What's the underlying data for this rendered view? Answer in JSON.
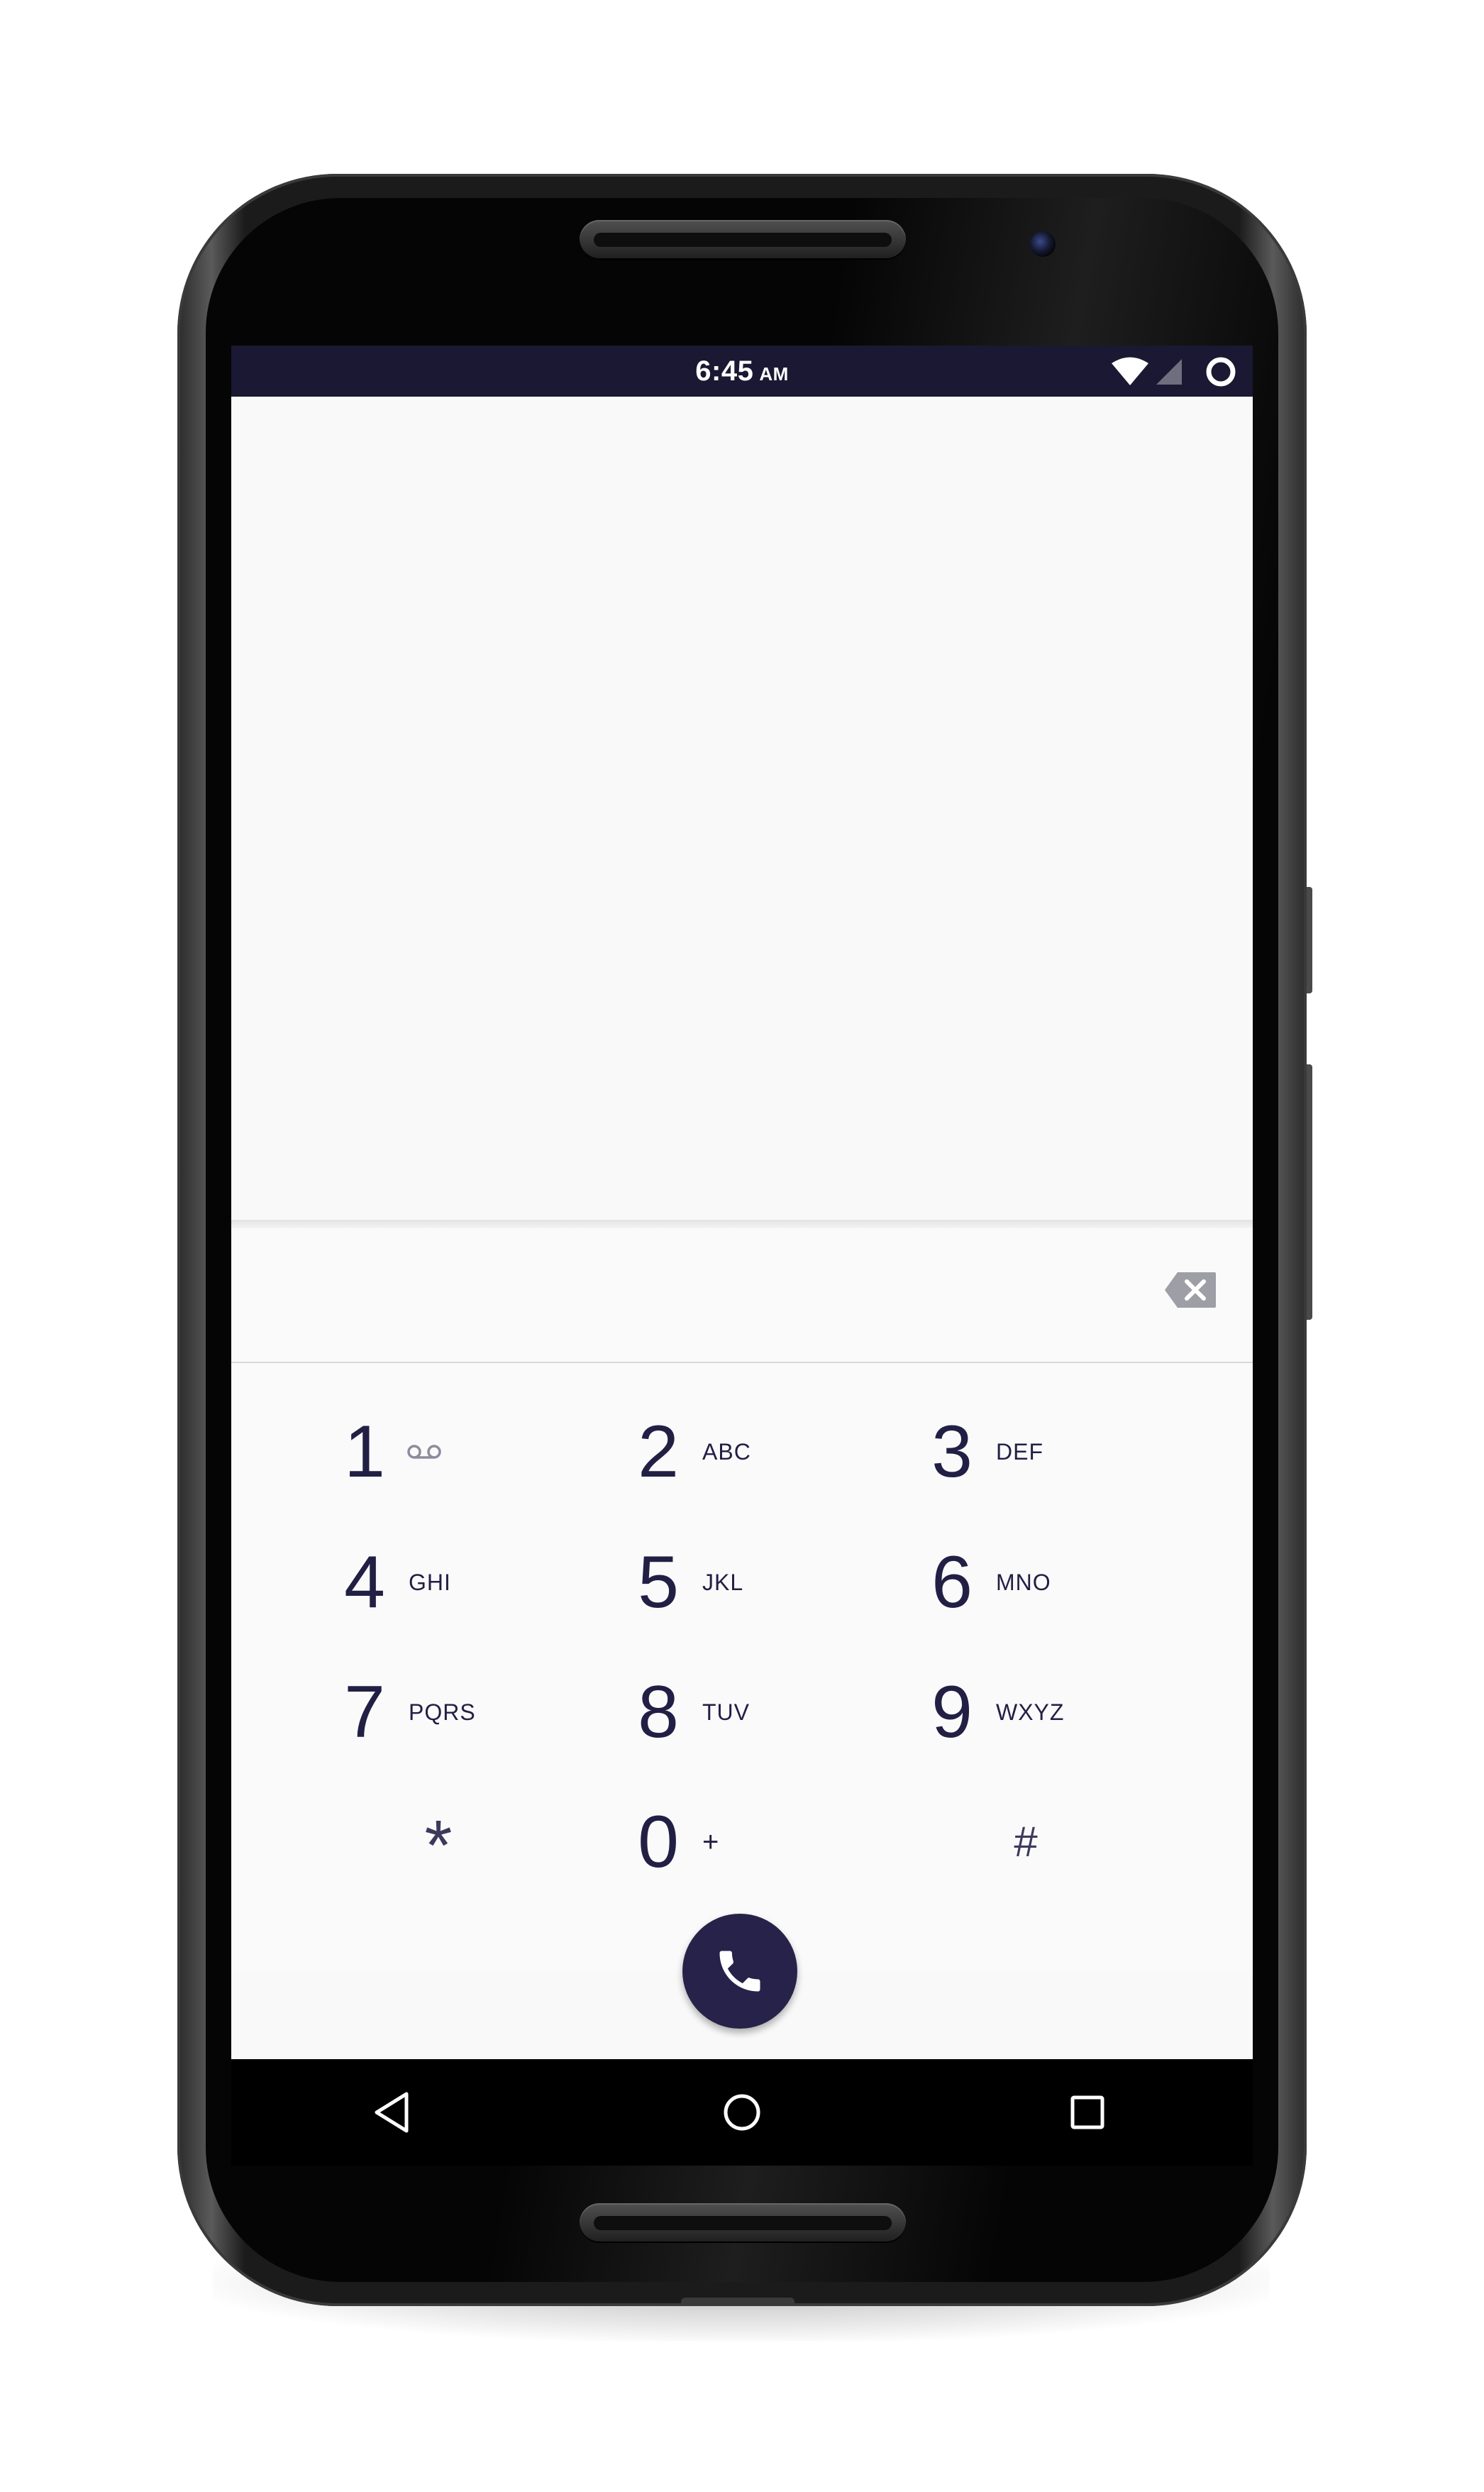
{
  "status_bar": {
    "time": "6:45",
    "ampm": "AM",
    "icons": [
      "wifi-icon",
      "cellular-signal-icon",
      "battery-charging-icon"
    ]
  },
  "dialer": {
    "digits_value": "",
    "digits_placeholder": "",
    "backspace_icon": "backspace-icon",
    "keys": [
      {
        "digit": "1",
        "letters": "",
        "icon": "voicemail-icon"
      },
      {
        "digit": "2",
        "letters": "ABC"
      },
      {
        "digit": "3",
        "letters": "DEF"
      },
      {
        "digit": "4",
        "letters": "GHI"
      },
      {
        "digit": "5",
        "letters": "JKL"
      },
      {
        "digit": "6",
        "letters": "MNO"
      },
      {
        "digit": "7",
        "letters": "PQRS"
      },
      {
        "digit": "8",
        "letters": "TUV"
      },
      {
        "digit": "9",
        "letters": "WXYZ"
      },
      {
        "digit": "*",
        "letters": ""
      },
      {
        "digit": "0",
        "letters": "+"
      },
      {
        "digit": "#",
        "letters": ""
      }
    ],
    "call_icon": "phone-icon",
    "colors": {
      "accent": "#27224a",
      "status_bar": "#1a1832",
      "keypad_text": "#221f45"
    }
  },
  "navigation_bar": {
    "icons": [
      "back-icon",
      "home-icon",
      "recents-icon"
    ]
  }
}
